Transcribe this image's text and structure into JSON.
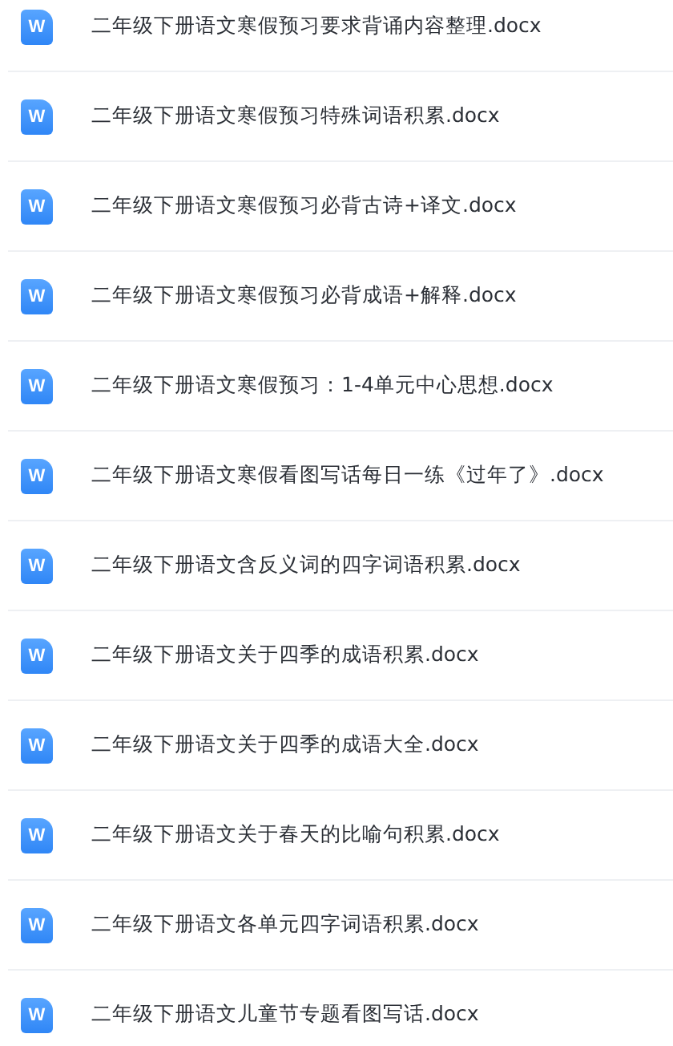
{
  "files": [
    {
      "icon_label": "W",
      "name": "二年级下册语文寒假预习要求背诵内容整理.docx"
    },
    {
      "icon_label": "W",
      "name": "二年级下册语文寒假预习特殊词语积累.docx"
    },
    {
      "icon_label": "W",
      "name": "二年级下册语文寒假预习必背古诗+译文.docx"
    },
    {
      "icon_label": "W",
      "name": "二年级下册语文寒假预习必背成语+解释.docx"
    },
    {
      "icon_label": "W",
      "name": "二年级下册语文寒假预习：1-4单元中心思想.docx"
    },
    {
      "icon_label": "W",
      "name": "二年级下册语文寒假看图写话每日一练《过年了》.docx"
    },
    {
      "icon_label": "W",
      "name": "二年级下册语文含反义词的四字词语积累.docx"
    },
    {
      "icon_label": "W",
      "name": "二年级下册语文关于四季的成语积累.docx"
    },
    {
      "icon_label": "W",
      "name": "二年级下册语文关于四季的成语大全.docx"
    },
    {
      "icon_label": "W",
      "name": "二年级下册语文关于春天的比喻句积累.docx"
    },
    {
      "icon_label": "W",
      "name": "二年级下册语文各单元四字词语积累.docx"
    },
    {
      "icon_label": "W",
      "name": "二年级下册语文儿童节专题看图写话.docx"
    }
  ]
}
